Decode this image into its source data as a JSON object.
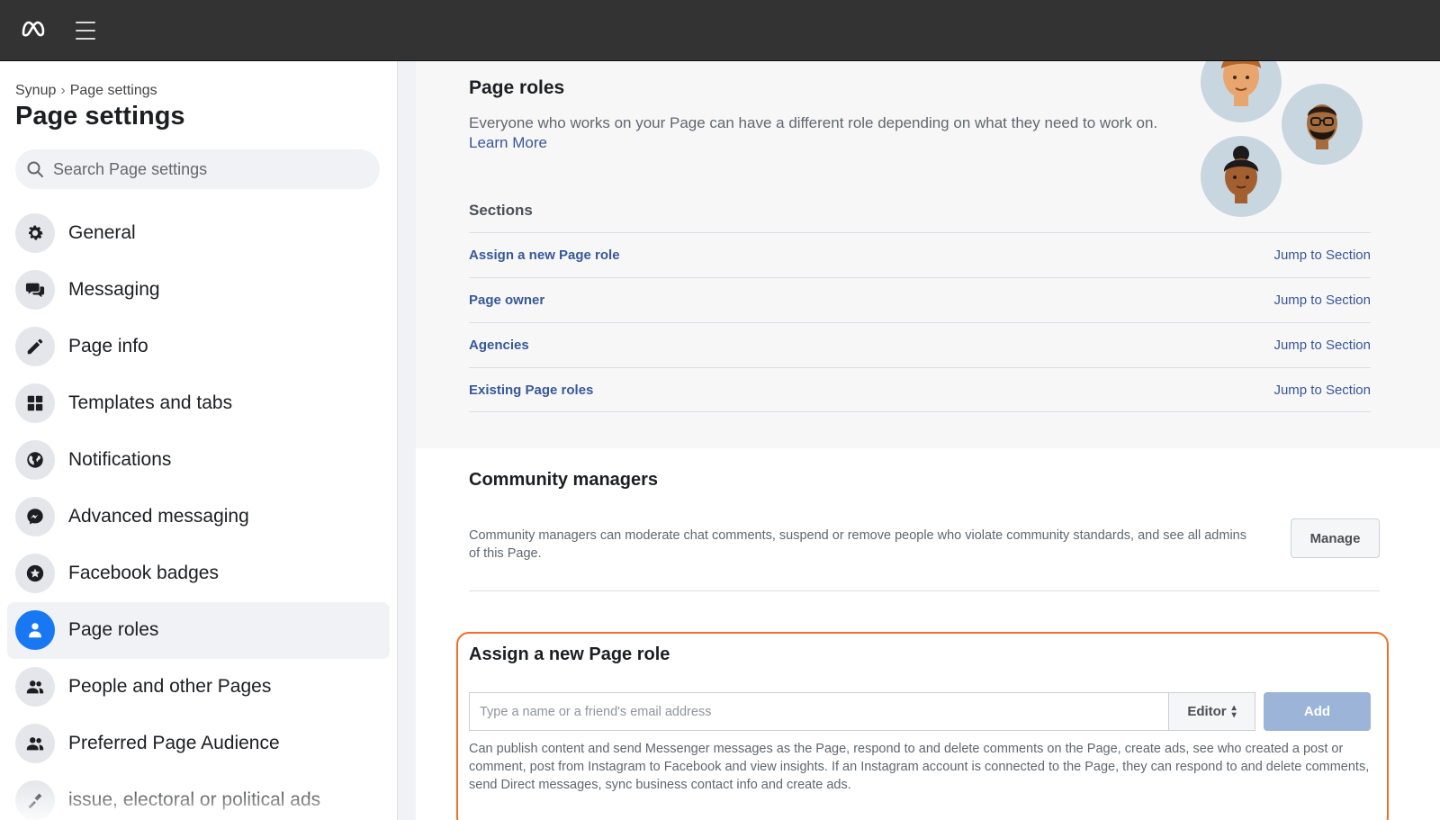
{
  "header": {
    "logo_icon": "meta-logo-icon",
    "menu_icon": "hamburger-menu-icon"
  },
  "sidebar": {
    "breadcrumb": {
      "parent": "Synup",
      "separator": "›",
      "current": "Page settings"
    },
    "title": "Page settings",
    "search": {
      "placeholder": "Search Page settings",
      "value": ""
    },
    "items": [
      {
        "label": "General",
        "icon": "gear-icon",
        "active": false
      },
      {
        "label": "Messaging",
        "icon": "chat-bubbles-icon",
        "active": false
      },
      {
        "label": "Page info",
        "icon": "pencil-icon",
        "active": false
      },
      {
        "label": "Templates and tabs",
        "icon": "grid-icon",
        "active": false
      },
      {
        "label": "Notifications",
        "icon": "globe-icon",
        "active": false
      },
      {
        "label": "Advanced messaging",
        "icon": "messenger-icon",
        "active": false
      },
      {
        "label": "Facebook badges",
        "icon": "star-badge-icon",
        "active": false
      },
      {
        "label": "Page roles",
        "icon": "person-icon",
        "active": true
      },
      {
        "label": "People and other Pages",
        "icon": "people-icon",
        "active": false
      },
      {
        "label": "Preferred Page Audience",
        "icon": "people-icon",
        "active": false
      },
      {
        "label": "issue, electoral or political ads",
        "icon": "megaphone-icon",
        "active": false
      }
    ]
  },
  "main": {
    "page_roles": {
      "title": "Page roles",
      "description": "Everyone who works on your Page can have a different role depending on what they need to work on.",
      "learn_more": "Learn More"
    },
    "sections": {
      "title": "Sections",
      "rows": [
        {
          "name": "Assign a new Page role",
          "jump": "Jump to Section"
        },
        {
          "name": "Page owner",
          "jump": "Jump to Section"
        },
        {
          "name": "Agencies",
          "jump": "Jump to Section"
        },
        {
          "name": "Existing Page roles",
          "jump": "Jump to Section"
        }
      ]
    },
    "community_managers": {
      "title": "Community managers",
      "description": "Community managers can moderate chat comments, suspend or remove people who violate community standards, and see all admins of this Page.",
      "manage_label": "Manage"
    },
    "assign_role": {
      "title": "Assign a new Page role",
      "input_placeholder": "Type a name or a friend's email address",
      "input_value": "",
      "role_selected": "Editor",
      "add_label": "Add",
      "description": "Can publish content and send Messenger messages as the Page, respond to and delete comments on the Page, create ads, see who created a post or comment, post from Instagram to Facebook and view insights. If an Instagram account is connected to the Page, they can respond to and delete comments, send Direct messages, sync business contact info and create ads."
    }
  },
  "colors": {
    "topbar": "#333333",
    "link": "#385898",
    "active_icon": "#1877f2",
    "highlight_border": "#f07025",
    "add_button_disabled": "#9cb4d8"
  }
}
